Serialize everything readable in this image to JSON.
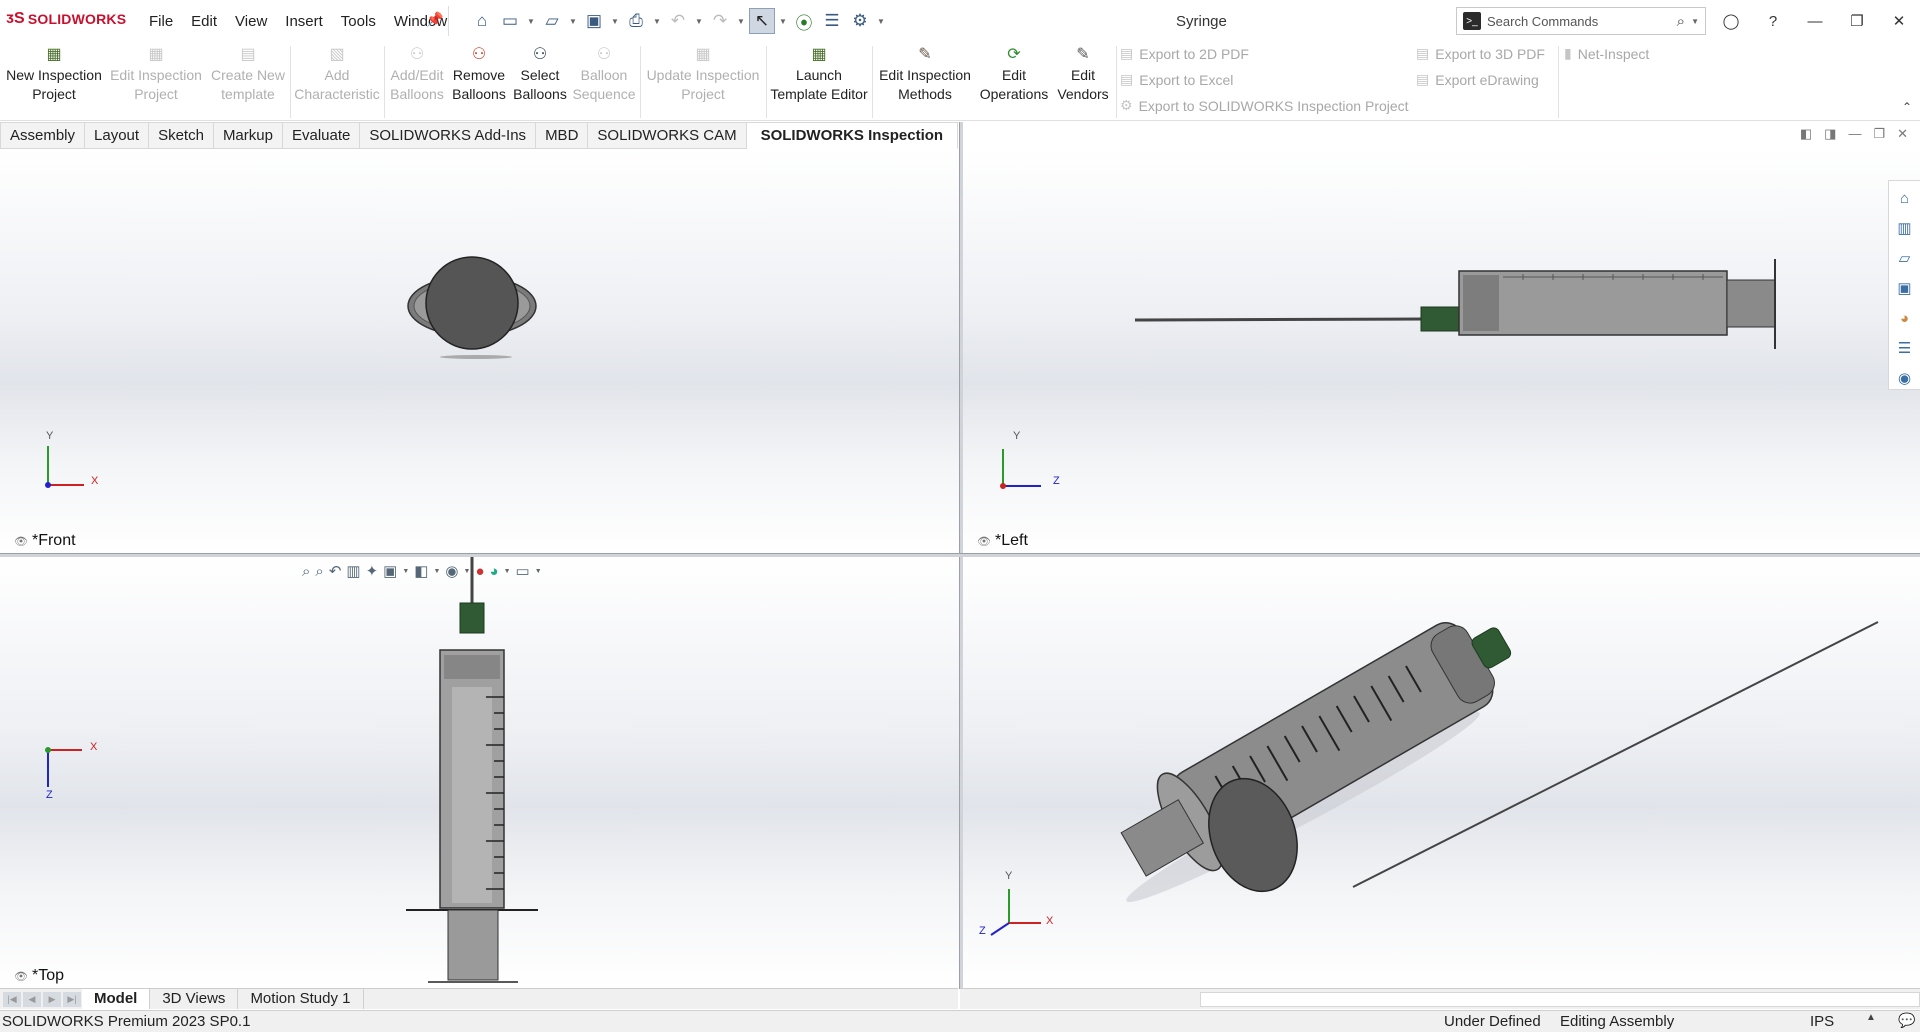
{
  "app": {
    "brand": "SOLIDWORKS",
    "document_title": "Syringe"
  },
  "menu": [
    "File",
    "Edit",
    "View",
    "Insert",
    "Tools",
    "Window"
  ],
  "search": {
    "placeholder": "Search Commands"
  },
  "ribbon": {
    "buttons": [
      {
        "line1": "New Inspection",
        "line2": "Project",
        "enabled": true,
        "icon": "new-project-icon"
      },
      {
        "line1": "Edit Inspection",
        "line2": "Project",
        "enabled": false,
        "icon": "edit-project-icon"
      },
      {
        "line1": "Create New",
        "line2": "template",
        "enabled": false,
        "icon": "template-icon"
      },
      {
        "line1": "Add",
        "line2": "Characteristic",
        "enabled": false,
        "icon": "characteristic-icon"
      },
      {
        "line1": "Add/Edit",
        "line2": "Balloons",
        "enabled": false,
        "icon": "balloons-icon"
      },
      {
        "line1": "Remove",
        "line2": "Balloons",
        "enabled": true,
        "icon": "remove-balloons-icon"
      },
      {
        "line1": "Select",
        "line2": "Balloons",
        "enabled": true,
        "icon": "select-balloons-icon"
      },
      {
        "line1": "Balloon",
        "line2": "Sequence",
        "enabled": false,
        "icon": "sequence-icon"
      },
      {
        "line1": "Update Inspection",
        "line2": "Project",
        "enabled": false,
        "icon": "update-project-icon"
      },
      {
        "line1": "Launch",
        "line2": "Template Editor",
        "enabled": true,
        "icon": "template-editor-icon"
      },
      {
        "line1": "Edit Inspection",
        "line2": "Methods",
        "enabled": true,
        "icon": "methods-icon"
      },
      {
        "line1": "Edit",
        "line2": "Operations",
        "enabled": true,
        "icon": "operations-icon"
      },
      {
        "line1": "Edit",
        "line2": "Vendors",
        "enabled": true,
        "icon": "vendors-icon"
      }
    ],
    "exports": {
      "pdf2d": "Export to 2D PDF",
      "excel": "Export to Excel",
      "sw_project": "Export to SOLIDWORKS Inspection Project",
      "pdf3d": "Export to 3D PDF",
      "edrawing": "Export eDrawing",
      "net": "Net-Inspect"
    }
  },
  "tabs": [
    {
      "label": "Assembly",
      "active": false
    },
    {
      "label": "Layout",
      "active": false
    },
    {
      "label": "Sketch",
      "active": false
    },
    {
      "label": "Markup",
      "active": false
    },
    {
      "label": "Evaluate",
      "active": false
    },
    {
      "label": "SOLIDWORKS Add-Ins",
      "active": false
    },
    {
      "label": "MBD",
      "active": false
    },
    {
      "label": "SOLIDWORKS CAM",
      "active": false
    },
    {
      "label": "SOLIDWORKS Inspection",
      "active": true
    }
  ],
  "viewports": {
    "front": {
      "label": "*Front",
      "axis1": "Y",
      "axis2": "X"
    },
    "left": {
      "label": "*Left",
      "axis1": "Y",
      "axis2": "Z"
    },
    "top": {
      "label": "*Top",
      "axis1": "X",
      "axis2": "Z"
    },
    "iso": {
      "axis1": "Y",
      "axis2": "X",
      "axis3": "Z"
    }
  },
  "bottom_tabs": [
    {
      "label": "Model",
      "active": true
    },
    {
      "label": "3D Views",
      "active": false
    },
    {
      "label": "Motion Study 1",
      "active": false
    }
  ],
  "status": {
    "version": "SOLIDWORKS Premium 2023 SP0.1",
    "defined": "Under Defined",
    "mode": "Editing Assembly",
    "units": "IPS"
  },
  "colors": {
    "accent": "#c8102e",
    "needle_hub": "#2f5a33",
    "barrel": "#8c8c8c"
  }
}
